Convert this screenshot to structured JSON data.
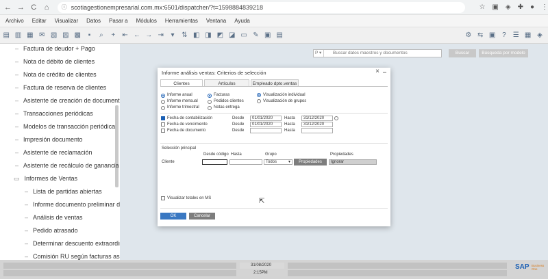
{
  "browser": {
    "url": "scotiagestionempresarial.com.mx:6501/dispatcher/?t=1598884839218",
    "back": "←",
    "forward": "→",
    "reload": "C",
    "home": "⌂"
  },
  "menubar": [
    "Archivo",
    "Editar",
    "Visualizar",
    "Datos",
    "Pasar a",
    "Módulos",
    "Herramientas",
    "Ventana",
    "Ayuda"
  ],
  "sidebar": {
    "items": [
      {
        "label": "Factura de deudor + Pago",
        "level": 1
      },
      {
        "label": "Nota de débito de clientes",
        "level": 1
      },
      {
        "label": "Nota de crédito de clientes",
        "level": 1
      },
      {
        "label": "Factura de reserva de clientes",
        "level": 1
      },
      {
        "label": "Asistente de creación de documentos",
        "level": 1
      },
      {
        "label": "Transacciones periódicas",
        "level": 1
      },
      {
        "label": "Modelos de transacción periódica",
        "level": 1
      },
      {
        "label": "Impresión documento",
        "level": 1
      },
      {
        "label": "Asistente de reclamación",
        "level": 1
      },
      {
        "label": "Asistente de recálculo de ganancia br",
        "level": 1
      },
      {
        "label": "Informes de Ventas",
        "level": 0
      },
      {
        "label": "Lista de partidas abiertas",
        "level": 2
      },
      {
        "label": "Informe documento preliminar de",
        "level": 2
      },
      {
        "label": "Análisis de ventas",
        "level": 2
      },
      {
        "label": "Pedido atrasado",
        "level": 2
      },
      {
        "label": "Determinar descuento extraordin",
        "level": 2
      },
      {
        "label": "Comisión RU según facturas as a",
        "level": 2
      }
    ]
  },
  "search": {
    "prefix": "P ▾",
    "placeholder": "Buscar datos maestros y documentos",
    "buscar_label": "Buscar",
    "busqueda_label": "Búsqueda por modelo"
  },
  "dialog": {
    "title": "Informe análisis ventas: Criterios de selección",
    "close": "×",
    "tabs": [
      {
        "label": "Clientes",
        "active": true
      },
      {
        "label": "Artículos",
        "active": false
      },
      {
        "label": "Empleado dpto.ventas",
        "active": false
      }
    ],
    "period": {
      "anual": "Informe anual",
      "mensual": "Informe mensual",
      "trimestral": "Informe trimestral"
    },
    "doc": {
      "facturas": "Facturas",
      "pedidos": "Pedidos clientes",
      "notas": "Notas entrega"
    },
    "view": {
      "individual": "Visualización individual",
      "grupos": "Visualización de grupos"
    },
    "dates": {
      "desde": "Desde",
      "hasta": "Hasta",
      "contabilizacion": "Fecha de contabilización",
      "vencimiento": "Fecha de vencimiento",
      "documento": "Fecha de documento",
      "cont_from": "01/01/2020",
      "cont_to": "31/12/2020",
      "venc_from": "01/01/2020",
      "venc_to": "31/12/2020"
    },
    "selection": {
      "title": "Selección principal",
      "desde_codigo": "Desde código",
      "hasta": "Hasta",
      "grupo": "Grupo",
      "propiedades": "Propiedades",
      "cliente": "Cliente",
      "grupo_value": "Todos",
      "prop_button": "Propiedades",
      "prop_value": "Ignorar"
    },
    "totals_label": "Visualizar totales en MS",
    "ok": "OK",
    "cancel": "Cancelar"
  },
  "status": {
    "date": "31/08/2020",
    "time": "2:15PM",
    "brand": "SAP",
    "brand_sub1": "Business",
    "brand_sub2": "One"
  }
}
